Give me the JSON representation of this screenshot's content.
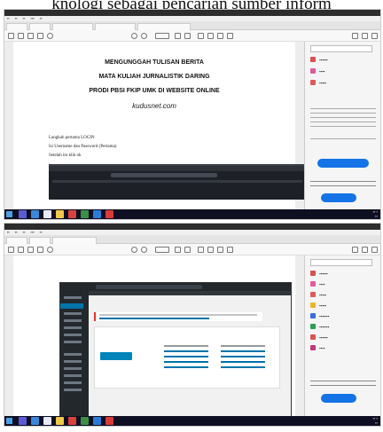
{
  "caption": "knologi sebagai pencarian sumber inform",
  "shot1": {
    "document": {
      "heading_1": "MENGUNGGAH TULISAN BERITA",
      "heading_2": "MATA KULIAH JURNALISTIK DARING",
      "heading_3": "PRODI PBSI FKIP UMK  DI WEBSITE ONLINE",
      "website": "kudusnet.com",
      "step_1": "Langkah pertama LOGIN",
      "step_2": "Isi Username dan Password (Pertama)",
      "step_3": "Setelah itu klik ok"
    }
  }
}
